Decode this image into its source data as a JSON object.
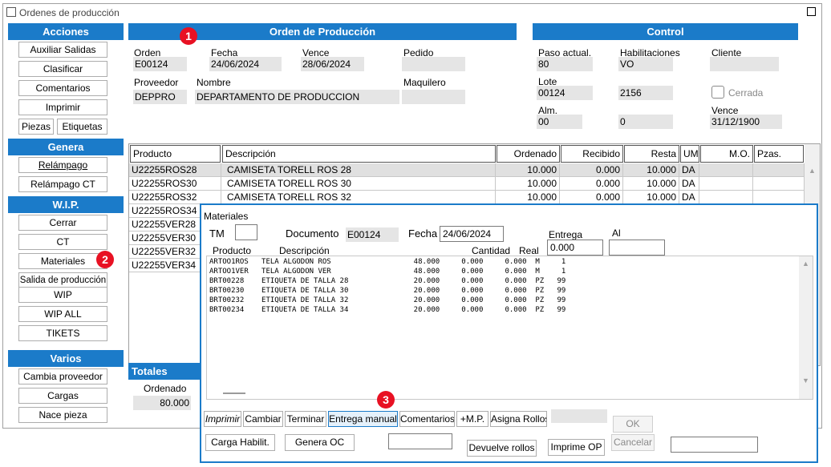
{
  "window": {
    "title": "Ordenes de producción"
  },
  "sidebar": {
    "acciones": {
      "header": "Acciones",
      "auxiliar": "Auxiliar Salidas",
      "clasificar": "Clasificar",
      "comentarios": "Comentarios",
      "imprimir": "Imprimir",
      "piezas": "Piezas",
      "etiquetas": "Etiquetas"
    },
    "genera": {
      "header": "Genera",
      "relampago": "Relámpago",
      "relampago_ct": "Relámpago CT"
    },
    "wip": {
      "header": "W.I.P.",
      "cerrar": "Cerrar",
      "ct": "CT",
      "materiales": "Materiales",
      "salida": "Salida de producción",
      "wip": "WIP",
      "wip_all": "WIP ALL",
      "tikets": "TIKETS"
    },
    "varios": {
      "header": "Varios",
      "cambia_proveedor": "Cambia proveedor",
      "cargas": "Cargas",
      "nace_pieza": "Nace pieza"
    }
  },
  "badges": {
    "b1": "1",
    "b2": "2",
    "b3": "3"
  },
  "orden": {
    "header": "Orden de Producción",
    "orden_label": "Orden",
    "orden_value": "E00124",
    "fecha_label": "Fecha",
    "fecha_value": "24/06/2024",
    "vence_label": "Vence",
    "vence_value": "28/06/2024",
    "pedido_label": "Pedido",
    "pedido_value": "",
    "proveedor_label": "Proveedor",
    "proveedor_value": "DEPPRO",
    "nombre_label": "Nombre",
    "nombre_value": "DEPARTAMENTO  DE PRODUCCION",
    "maquilero_label": "Maquilero",
    "maquilero_value": ""
  },
  "control": {
    "header": "Control",
    "paso_label": "Paso actual.",
    "paso_value": "80",
    "habil_label": "Habilitaciones",
    "habil_value": "VO",
    "cliente_label": "Cliente",
    "cliente_value": "",
    "lote_label": "Lote",
    "lote_value": "00124",
    "lote_value2": "2156",
    "cerrada_label": "Cerrada",
    "alm_label": "Alm.",
    "alm_value": "00",
    "alm_value2": "0",
    "vence_label": "Vence",
    "vence_value": "31/12/1900"
  },
  "grid": {
    "headers": [
      "Producto",
      "Descripción",
      "Ordenado",
      "Recibido",
      "Resta",
      "UM",
      "M.O.",
      "Pzas."
    ],
    "rows": [
      {
        "producto": "U22255ROS28",
        "descripcion": "CAMISETA TORELL ROS 28",
        "ordenado": "10.000",
        "recibido": "0.000",
        "resta": "10.000",
        "um": "DA"
      },
      {
        "producto": "U22255ROS30",
        "descripcion": "CAMISETA TORELL ROS 30",
        "ordenado": "10.000",
        "recibido": "0.000",
        "resta": "10.000",
        "um": "DA"
      },
      {
        "producto": "U22255ROS32",
        "descripcion": "CAMISETA TORELL ROS 32",
        "ordenado": "10.000",
        "recibido": "0.000",
        "resta": "10.000",
        "um": "DA"
      },
      {
        "producto": "U22255ROS34"
      },
      {
        "producto": "U22255VER28"
      },
      {
        "producto": "U22255VER30"
      },
      {
        "producto": "U22255VER32"
      },
      {
        "producto": "U22255VER34"
      }
    ]
  },
  "totales": {
    "header": "Totales",
    "ordenado_label": "Ordenado",
    "ordenado_value": "80.000"
  },
  "materiales": {
    "title": "Materiales",
    "tm_label": "TM",
    "tm_value": "",
    "documento_label": "Documento",
    "documento_value": "E00124",
    "fecha_label": "Fecha",
    "fecha_value": "24/06/2024",
    "entrega_label": "Entrega",
    "entrega_value": "0.000",
    "al_label": "Al",
    "al_value": "",
    "col_producto": "Producto",
    "col_descripcion": "Descripción",
    "col_cantidad": "Cantidad",
    "col_real": "Real",
    "rows": [
      "ARTOO1ROS   TELA ALGODON ROS                   48.000     0.000     0.000  M     1",
      "ARTOO1VER   TELA ALGODON VER                   48.000     0.000     0.000  M     1",
      "BRT00228    ETIQUETA DE TALLA 28               20.000     0.000     0.000  PZ   99",
      "BRT00230    ETIQUETA DE TALLA 30               20.000     0.000     0.000  PZ   99",
      "BRT00232    ETIQUETA DE TALLA 32               20.000     0.000     0.000  PZ   99",
      "BRT00234    ETIQUETA DE TALLA 34               20.000     0.000     0.000  PZ   99"
    ],
    "buttons": {
      "imprimir": "Imprimir",
      "cambiar": "Cambiar",
      "terminar": "Terminar",
      "entrega_manual": "Entrega manual",
      "comentarios": "Comentarios",
      "mp": "+M.P.",
      "asigna_rollos": "Asigna Rollos",
      "ok": "OK",
      "carga_habilit": "Carga Habilit.",
      "genera_oc": "Genera OC",
      "devuelve_rollos": "Devuelve rollos",
      "imprime_op": "Imprime OP",
      "cancelar": "Cancelar"
    }
  },
  "colors": {
    "accent": "#1b7bc9",
    "badge": "#e81123",
    "field_bg": "#e5e5e5"
  }
}
